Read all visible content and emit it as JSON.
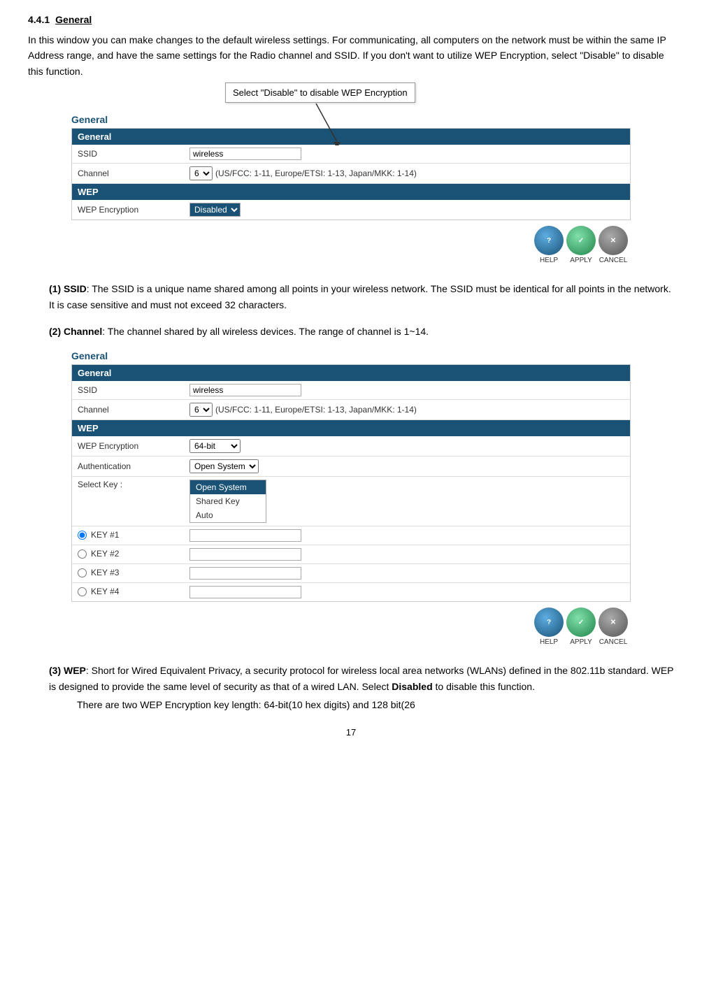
{
  "page": {
    "section": "4.4.1",
    "title": "General",
    "intro": "In this window you can make changes to the default wireless settings. For communicating, all computers on the network must be within the same IP Address range, and have the same settings for the Radio channel and SSID. If you don't want to utilize WEP Encryption, select \"Disable\" to disable this function.",
    "callout": "Select \"Disable\" to disable WEP Encryption",
    "panel1": {
      "label": "General",
      "header": "General",
      "ssid_label": "SSID",
      "ssid_value": "wireless",
      "channel_label": "Channel",
      "channel_value": "6",
      "channel_info": "(US/FCC: 1-11, Europe/ETSI: 1-13, Japan/MKK: 1-14)",
      "wep_header": "WEP",
      "wep_label": "WEP Encryption",
      "wep_value": "Disabled"
    },
    "panel2": {
      "label": "General",
      "header": "General",
      "ssid_label": "SSID",
      "ssid_value": "wireless",
      "channel_label": "Channel",
      "channel_value": "6",
      "channel_info": "(US/FCC: 1-11, Europe/ETSI: 1-13, Japan/MKK: 1-14)",
      "wep_header": "WEP",
      "wep_label": "WEP Encryption",
      "wep_value": "64-bit",
      "auth_label": "Authentication",
      "auth_value": "Open System",
      "selectkey_label": "Select Key :",
      "dropdown_items": [
        "Open System",
        "Shared Key",
        "Auto"
      ],
      "dropdown_selected": "Open System",
      "key1_label": "KEY #1",
      "key2_label": "KEY #2",
      "key3_label": "KEY #3",
      "key4_label": "KEY #4"
    },
    "buttons": {
      "help": "HELP",
      "apply": "APPLY",
      "cancel": "CANCEL"
    },
    "items": [
      {
        "num": "(1)",
        "bold": "SSID",
        "text": ": The SSID is a unique name shared among all points in your wireless network. The SSID must be identical for all points in the network. It is case sensitive and must not exceed 32 characters."
      },
      {
        "num": "(2)",
        "bold": "Channel",
        "text": ": The channel shared by all wireless devices. The range of channel is 1~14."
      },
      {
        "num": "(3)",
        "bold": "WEP",
        "text": ": Short for Wired Equivalent Privacy, a security protocol for wireless local area networks (WLANs) defined in the 802.11b standard. WEP is designed to provide the same level of security as that of a wired LAN. Select Disabled to disable this function.",
        "sub": "There are two WEP Encryption key length: 64-bit(10 hex digits) and 128 bit(26"
      }
    ],
    "page_number": "17"
  }
}
